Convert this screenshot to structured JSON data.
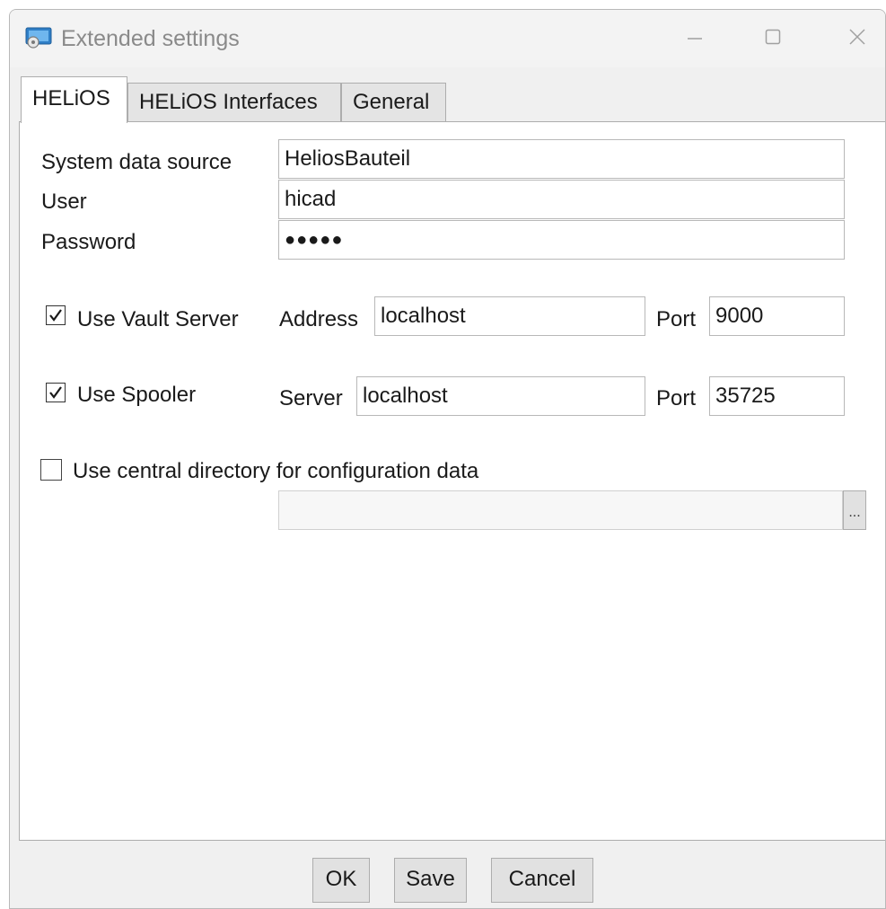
{
  "window": {
    "title": "Extended settings",
    "icon": "app-icon",
    "controls": [
      "minimize-icon",
      "maximize-icon",
      "close-icon"
    ]
  },
  "tabs": [
    {
      "label": "HELiOS",
      "active": true
    },
    {
      "label": "HELiOS Interfaces",
      "active": false
    },
    {
      "label": "General",
      "active": false
    }
  ],
  "helios": {
    "system_data_source": {
      "label": "System data source",
      "value": "HeliosBauteil"
    },
    "user": {
      "label": "User",
      "value": "hicad"
    },
    "password": {
      "label": "Password",
      "value": "●●●●●"
    },
    "vault": {
      "checkbox_label": "Use Vault Server",
      "checked": true,
      "address_label": "Address",
      "address_value": "localhost",
      "port_label": "Port",
      "port_value": "9000"
    },
    "spooler": {
      "checkbox_label": "Use Spooler",
      "checked": true,
      "server_label": "Server",
      "server_value": "localhost",
      "port_label": "Port",
      "port_value": "35725"
    },
    "central_directory": {
      "checkbox_label": "Use central directory for configuration data",
      "checked": false,
      "path_value": "",
      "browse_label": "..."
    }
  },
  "buttons": {
    "ok": "OK",
    "save": "Save",
    "cancel": "Cancel"
  }
}
